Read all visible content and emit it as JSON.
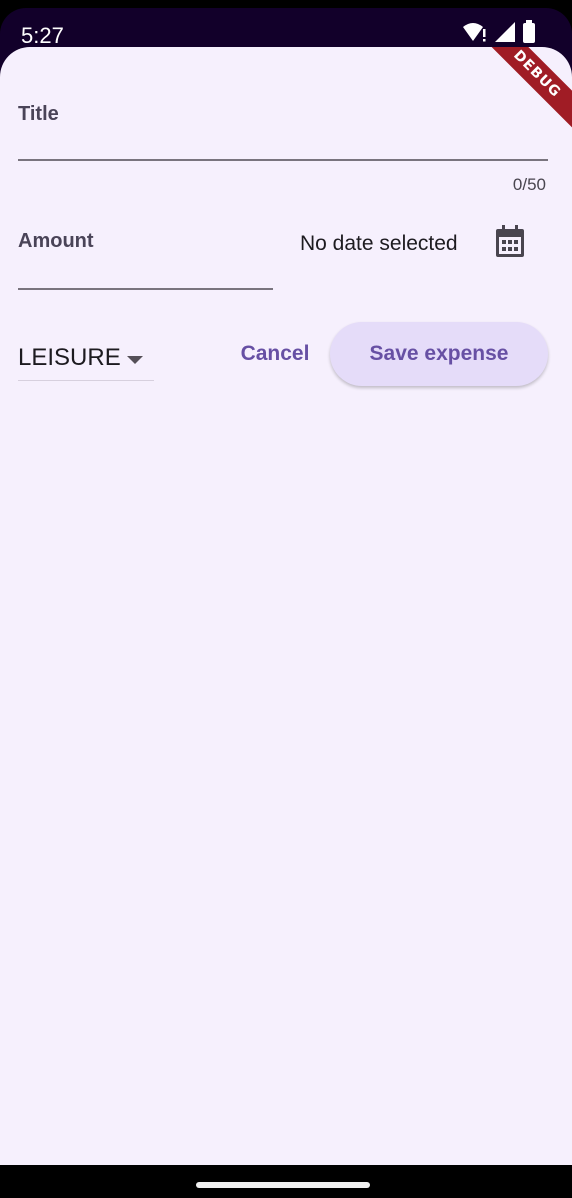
{
  "status_bar": {
    "time": "5:27",
    "icons": [
      "wifi-alert-icon",
      "cellular-signal-icon",
      "battery-icon"
    ],
    "background": "#12002a"
  },
  "debug_banner": {
    "label": "DEBUG",
    "color": "#a01c25"
  },
  "form": {
    "title_field": {
      "label": "Title",
      "value": "",
      "counter": "0/50"
    },
    "amount_field": {
      "label": "Amount",
      "value": ""
    },
    "date": {
      "text": "No date selected",
      "icon": "calendar-icon"
    },
    "category": {
      "selected": "LEISURE",
      "icon": "dropdown-arrow-icon"
    },
    "actions": {
      "cancel_label": "Cancel",
      "save_label": "Save expense"
    }
  },
  "colors": {
    "sheet_background": "#f6f0fd",
    "accent": "#6750a4",
    "save_button_background": "#e5dcf9"
  }
}
